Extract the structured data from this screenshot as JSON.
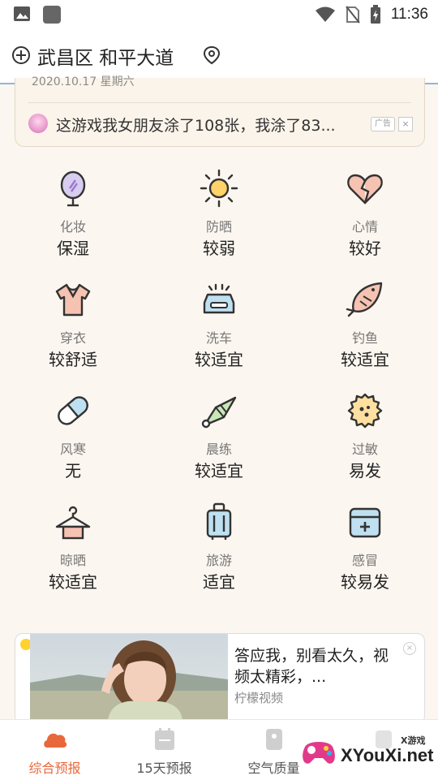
{
  "status_bar": {
    "time": "11:36"
  },
  "location": {
    "name": "武昌区 和平大道"
  },
  "top_card": {
    "date_partial": "2020.10.17 星期六",
    "ad_text": "这游戏我女朋友涂了108张，我涂了83...",
    "ad_tag": "广告",
    "ad_close": "×"
  },
  "indices": [
    {
      "label": "化妆",
      "value": "保湿",
      "icon": "mirror-icon"
    },
    {
      "label": "防晒",
      "value": "较弱",
      "icon": "sun-icon"
    },
    {
      "label": "心情",
      "value": "较好",
      "icon": "heart-icon"
    },
    {
      "label": "穿衣",
      "value": "较舒适",
      "icon": "shirt-icon"
    },
    {
      "label": "洗车",
      "value": "较适宜",
      "icon": "car-wash-icon"
    },
    {
      "label": "钓鱼",
      "value": "较适宜",
      "icon": "fish-icon"
    },
    {
      "label": "风寒",
      "value": "无",
      "icon": "pill-icon"
    },
    {
      "label": "晨练",
      "value": "较适宜",
      "icon": "shuttlecock-icon"
    },
    {
      "label": "过敏",
      "value": "易发",
      "icon": "allergy-gear-icon"
    },
    {
      "label": "晾晒",
      "value": "较适宜",
      "icon": "hanger-icon"
    },
    {
      "label": "旅游",
      "value": "适宜",
      "icon": "suitcase-icon"
    },
    {
      "label": "感冒",
      "value": "较易发",
      "icon": "medicine-box-icon"
    }
  ],
  "big_ad": {
    "title": "答应我，别看太久，视频太精彩，...",
    "source": "柠檬视频"
  },
  "bottom_nav": [
    {
      "label": "综合预报",
      "icon": "cloud-icon",
      "active": true
    },
    {
      "label": "15天预报",
      "icon": "calendar-icon",
      "active": false
    },
    {
      "label": "空气质量",
      "icon": "air-quality-icon",
      "active": false
    },
    {
      "label": "",
      "icon": "unknown-icon",
      "active": false
    }
  ],
  "watermark": {
    "main": "XYouXi.net",
    "small": "X游戏"
  },
  "colors": {
    "accent": "#e8673b",
    "background": "#fbf6ef"
  }
}
